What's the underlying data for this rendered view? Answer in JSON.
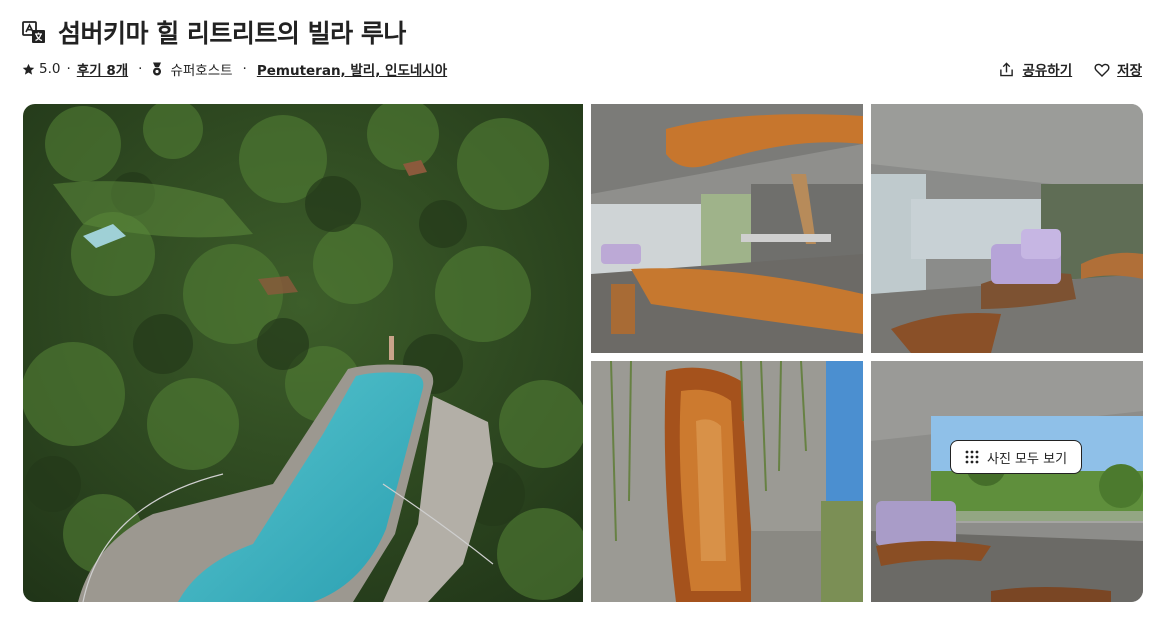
{
  "listing": {
    "title": "섬버키마 힐 리트리트의 빌라 루나",
    "rating": "5.0",
    "reviews_link": "후기 8개",
    "superhost_label": "슈퍼호스트",
    "location_link": "Pemuteran, 발리, 인도네시아",
    "share_label": "공유하기",
    "save_label": "저장",
    "show_all_photos_label": "사진 모두 보기"
  },
  "icons": {
    "translate": "translate-icon",
    "star": "star-icon",
    "superhost": "superhost-icon",
    "share": "share-icon",
    "heart": "heart-icon",
    "grid": "grid-dots-icon"
  },
  "colors": {
    "text": "#222222",
    "background": "#ffffff",
    "pool": "#3fb3c4",
    "forest": "#2f4a22"
  }
}
